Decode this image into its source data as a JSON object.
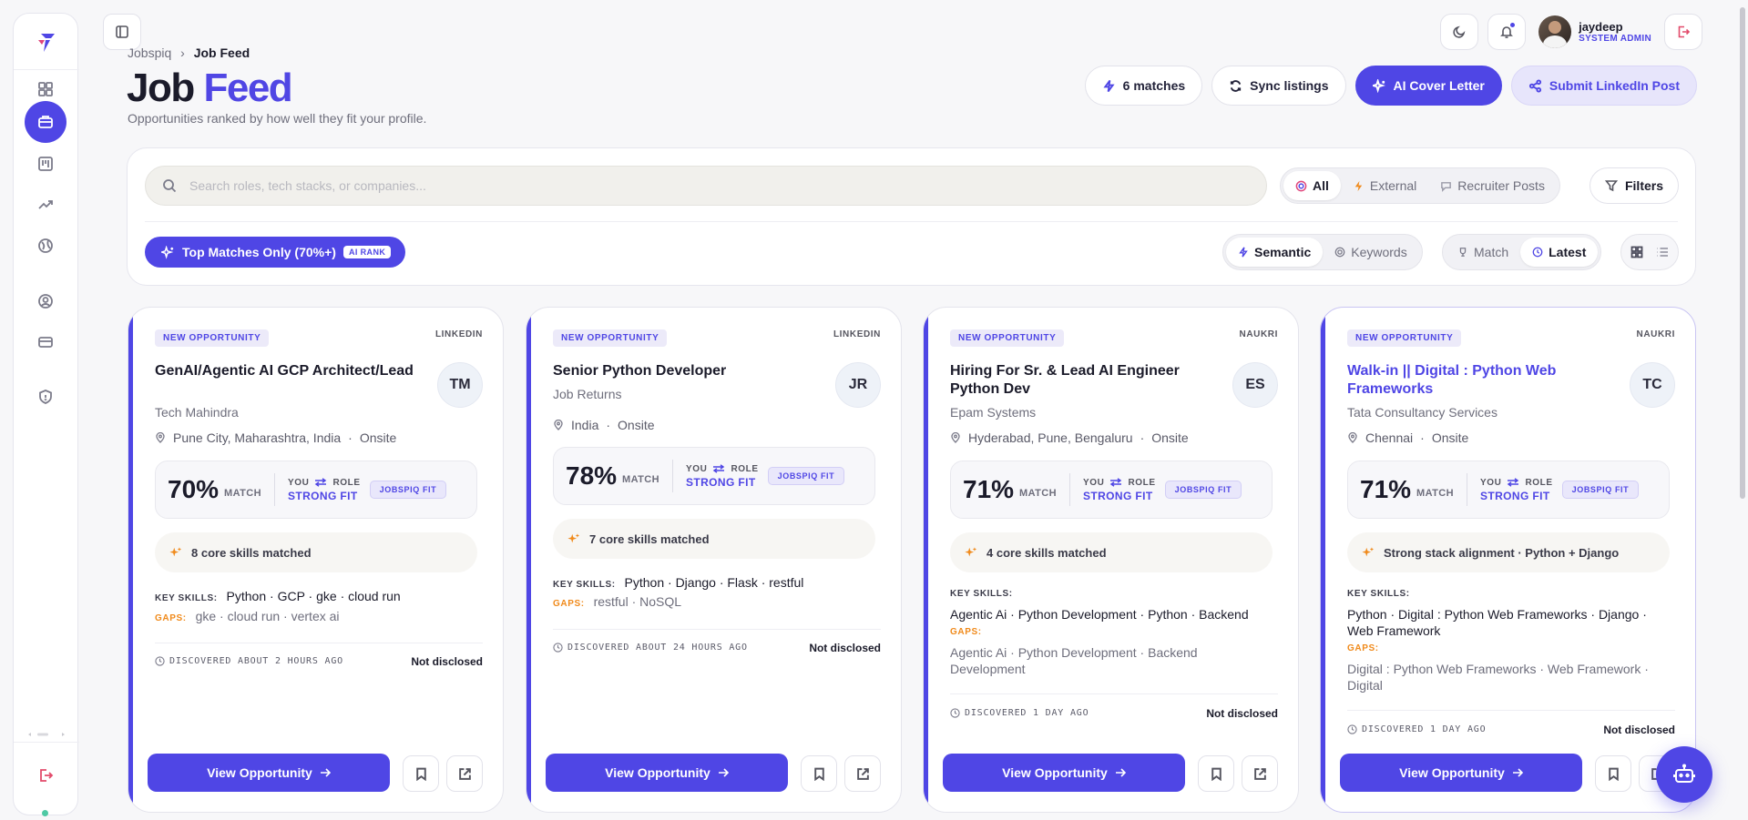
{
  "breadcrumb": {
    "root": "Jobspiq",
    "separator": "›",
    "current": "Job Feed"
  },
  "page": {
    "title_main": "Job",
    "title_accent": "Feed",
    "subtitle": "Opportunities ranked by how well they fit your profile."
  },
  "user": {
    "name": "jaydeep",
    "role": "SYSTEM ADMIN"
  },
  "actions": {
    "matches": "6 matches",
    "sync": "Sync listings",
    "cover_letter": "AI Cover Letter",
    "linkedin": "Submit LinkedIn Post"
  },
  "search": {
    "placeholder": "Search roles, tech stacks, or companies..."
  },
  "source_filter": {
    "all": "All",
    "external": "External",
    "recruiter": "Recruiter Posts",
    "selected": "All"
  },
  "filters_label": "Filters",
  "top_matches": {
    "label": "Top Matches Only (70%+)",
    "badge": "AI RANK"
  },
  "mode_filter": {
    "semantic": "Semantic",
    "keywords": "Keywords",
    "selected": "Semantic"
  },
  "sort_filter": {
    "match": "Match",
    "latest": "Latest",
    "selected": "Latest"
  },
  "card_labels": {
    "new": "NEW OPPORTUNITY",
    "match": "MATCH",
    "you": "YOU",
    "role": "ROLE",
    "fit": "STRONG FIT",
    "jobspiq_fit": "JOBSPIQ FIT",
    "key_skills": "KEY SKILLS:",
    "gaps": "GAPS:",
    "view": "View Opportunity",
    "location_sep": "·"
  },
  "jobs": [
    {
      "source": "LINKEDIN",
      "title": "GenAI/Agentic AI GCP Architect/Lead",
      "company": "Tech Mahindra",
      "initials": "TM",
      "location": "Pune City, Maharashtra, India",
      "mode": "Onsite",
      "match": "70%",
      "insight": "8 core skills matched",
      "skills": "Python · GCP · gke · cloud run",
      "gaps": "gke · cloud run · vertex ai",
      "discovered": "DISCOVERED ABOUT 2 HOURS AGO",
      "salary": "Not disclosed"
    },
    {
      "source": "LINKEDIN",
      "title": "Senior Python Developer",
      "company": "Job Returns",
      "initials": "JR",
      "location": "India",
      "mode": "Onsite",
      "match": "78%",
      "insight": "7 core skills matched",
      "skills": "Python · Django · Flask · restful",
      "gaps": "restful · NoSQL",
      "discovered": "DISCOVERED ABOUT 24 HOURS AGO",
      "salary": "Not disclosed"
    },
    {
      "source": "NAUKRI",
      "title": "Hiring For Sr. & Lead AI Engineer Python Dev",
      "company": "Epam Systems",
      "initials": "ES",
      "location": "Hyderabad, Pune, Bengaluru",
      "mode": "Onsite",
      "match": "71%",
      "insight": "4 core skills matched",
      "skills": "Agentic Ai · Python Development · Python · Backend",
      "gaps": "Agentic Ai · Python Development · Backend Development",
      "discovered": "DISCOVERED 1 DAY AGO",
      "salary": "Not disclosed"
    },
    {
      "source": "NAUKRI",
      "title": "Walk-in || Digital : Python Web Frameworks",
      "company": "Tata Consultancy Services",
      "initials": "TC",
      "location": "Chennai",
      "mode": "Onsite",
      "match": "71%",
      "insight": "Strong stack alignment · Python + Django",
      "skills": "Python · Digital : Python Web Frameworks · Django · Web Framework",
      "gaps": "Digital : Python Web Frameworks · Web Framework · Digital",
      "discovered": "DISCOVERED 1 DAY AGO",
      "salary": "Not disclosed"
    }
  ],
  "colors": {
    "accent": "#4f46e5",
    "gaps": "#f08a1b",
    "status_dot": "#4ec9a4"
  }
}
